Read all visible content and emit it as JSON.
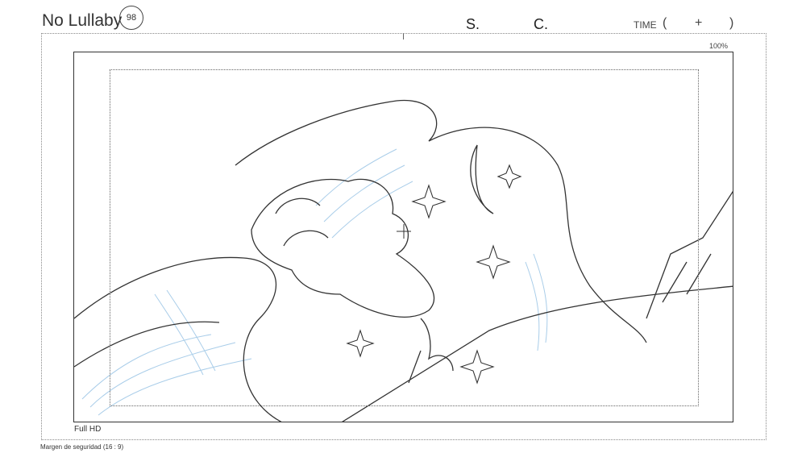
{
  "header": {
    "title": "No Lullaby",
    "stamp": "98",
    "scene_label": "S.",
    "cut_label": "C.",
    "time_label": "TIME",
    "time_open": "(",
    "time_plus": "+",
    "time_close": ")"
  },
  "frame": {
    "scale": "100%",
    "resolution_label": "Full HD",
    "safety_margin": "Margen de seguridad (16 : 9)"
  },
  "colors": {
    "line": "#333333",
    "shading": "#a9cde9"
  },
  "icons": [
    "center-crosshair-icon",
    "moon-icon",
    "sparkle-icon"
  ]
}
